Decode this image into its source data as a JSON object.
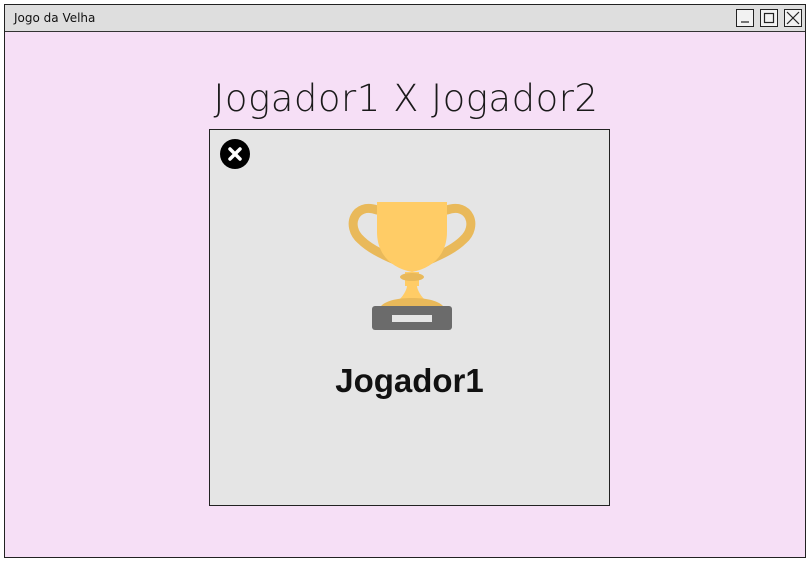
{
  "window": {
    "title": "Jogo da Velha",
    "background_color": "#f6dff6"
  },
  "heading": {
    "text": "Jogador1 X Jogador2"
  },
  "dialog": {
    "background_color": "#e5e5e5",
    "close_icon": "close-circle-icon",
    "trophy_icon": "trophy-icon",
    "trophy_color": "#ffcc66",
    "winner_name": "Jogador1"
  }
}
